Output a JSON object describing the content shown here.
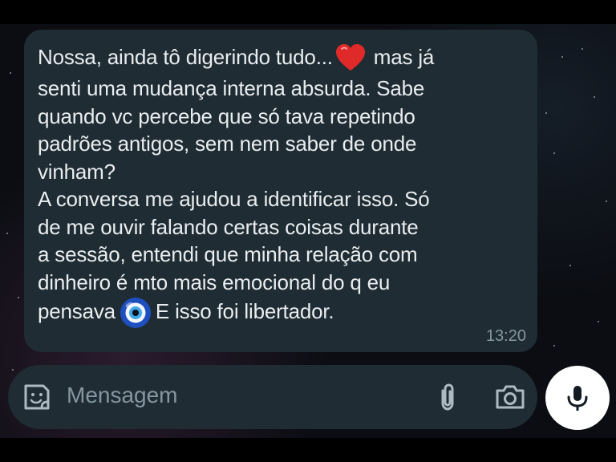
{
  "message": {
    "line1_before_emoji": "Nossa, ainda tô digerindo tudo...",
    "line1_after_emoji": "mas já",
    "body_middle": "senti uma mudança interna absurda. Sabe\nquando vc percebe que só tava repetindo\npadrões antigos, sem nem saber de onde\nvinham?\nA conversa me ajudou a identificar isso. Só\nde me ouvir falando certas coisas durante\na sessão, entendi que minha relação com\ndinheiro é mto mais emocional do q eu",
    "last_line_before_emoji": "pensava",
    "last_line_after_emoji": "E isso foi libertador.",
    "time": "13:20",
    "emoji_1": "red-heart-icon",
    "emoji_2": "nazar-amulet-icon"
  },
  "composer": {
    "placeholder": "Mensagem",
    "sticker_icon": "sticker-icon",
    "attach_icon": "paperclip-icon",
    "camera_icon": "camera-icon"
  },
  "mic": {
    "icon": "microphone-icon"
  },
  "colors": {
    "bubble": "#1f2c33",
    "text": "#e9edef",
    "muted": "#8696a0",
    "background": "#0b0d12"
  }
}
